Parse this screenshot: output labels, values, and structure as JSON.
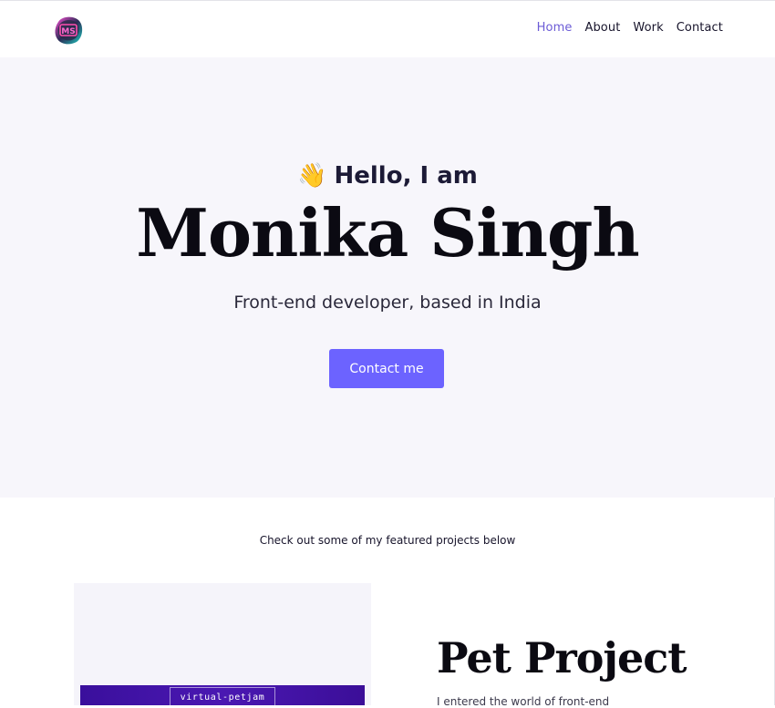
{
  "header": {
    "logo_text": "MS",
    "nav": [
      {
        "label": "Home",
        "active": true
      },
      {
        "label": "About",
        "active": false
      },
      {
        "label": "Work",
        "active": false
      },
      {
        "label": "Contact",
        "active": false
      }
    ]
  },
  "hero": {
    "wave_emoji": "👋",
    "greeting": "Hello, I am",
    "name": "Monika Singh",
    "tagline": "Front-end developer, based in India",
    "cta_label": "Contact me"
  },
  "projects": {
    "intro": "Check out some of my featured projects below",
    "items": [
      {
        "thumbnail_label": "virtual-petjam",
        "title": "Pet Project",
        "description": "I entered the world of front-end"
      }
    ]
  },
  "colors": {
    "accent": "#6c63ff",
    "nav_active": "#6b5bd6",
    "hero_bg": "#f7f6fb",
    "text_dark": "#17142b"
  }
}
